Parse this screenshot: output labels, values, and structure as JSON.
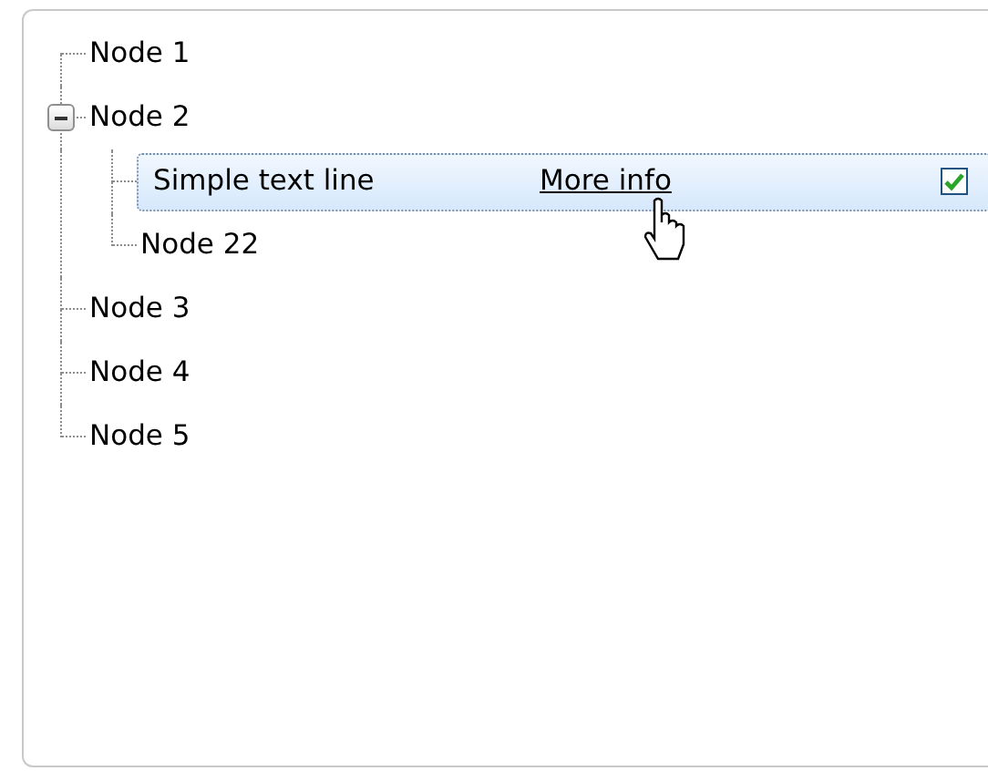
{
  "tree": [
    {
      "label": "Node 1",
      "selected": false
    },
    {
      "label": "Node 2",
      "selected": false,
      "expanded": true,
      "children": [
        {
          "kind": "rich",
          "label": "Simple text line",
          "link": "More info",
          "checked": true,
          "selected": true
        },
        {
          "kind": "plain",
          "label": "Node 22",
          "selected": false
        }
      ]
    },
    {
      "label": "Node 3",
      "selected": false
    },
    {
      "label": "Node 4",
      "selected": false
    },
    {
      "label": "Node 5",
      "selected": false
    }
  ]
}
